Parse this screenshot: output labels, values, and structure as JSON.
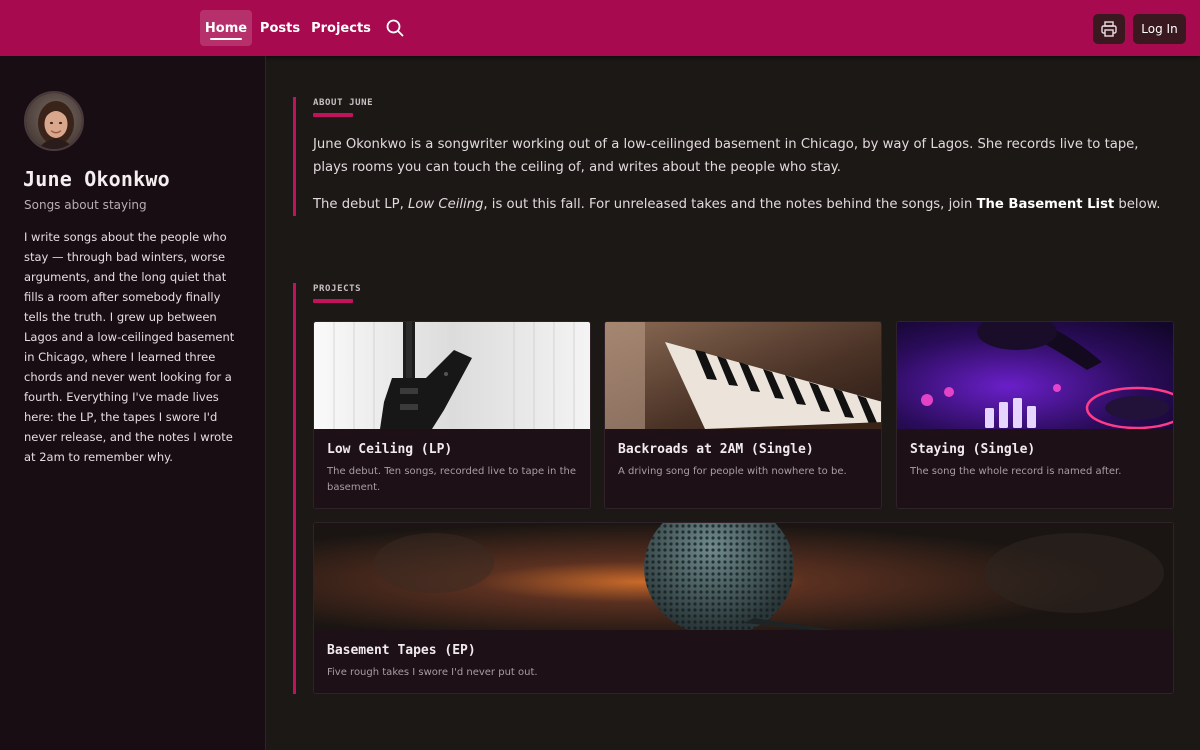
{
  "nav": {
    "items": [
      {
        "label": "Home",
        "active": true
      },
      {
        "label": "Posts",
        "active": false
      },
      {
        "label": "Projects",
        "active": false
      }
    ],
    "search_icon": "search-icon",
    "print_icon": "printer-icon",
    "login_label": "Log In"
  },
  "profile": {
    "name": "June Okonkwo",
    "tagline": "Songs about staying",
    "bio": "I write songs about the people who stay — through bad winters, worse arguments, and the long quiet that fills a room after somebody finally tells the truth. I grew up between Lagos and a low-ceilinged basement in Chicago, where I learned three chords and never went looking for a fourth. Everything I've made lives here: the LP, the tapes I swore I'd never release, and the notes I wrote at 2am to remember why."
  },
  "about": {
    "label": "ABOUT JUNE",
    "p1": "June Okonkwo is a songwriter working out of a low-ceilinged basement in Chicago, by way of Lagos. She records live to tape, plays rooms you can touch the ceiling of, and writes about the people who stay.",
    "p2_a": "The debut LP, ",
    "p2_em": "Low Ceiling",
    "p2_b": ", is out this fall. For unreleased takes and the notes behind the songs, join ",
    "p2_strong": "The Basement List",
    "p2_c": " below."
  },
  "projects": {
    "label": "PROJECTS",
    "items": [
      {
        "title": "Low Ceiling (LP)",
        "desc": "The debut. Ten songs, recorded live to tape in the basement.",
        "image": "guitar-photo"
      },
      {
        "title": "Backroads at 2AM (Single)",
        "desc": "A driving song for people with nowhere to be.",
        "image": "piano-photo"
      },
      {
        "title": "Staying (Single)",
        "desc": "The song the whole record is named after.",
        "image": "dj-mixer-photo"
      },
      {
        "title": "Basement Tapes (EP)",
        "desc": "Five rough takes I swore I'd never put out.",
        "image": "microphone-photo"
      }
    ]
  },
  "colors": {
    "accent": "#c0135b",
    "topbar": "#a80a50",
    "sidebar": "#170d12",
    "background": "#1c1816"
  }
}
